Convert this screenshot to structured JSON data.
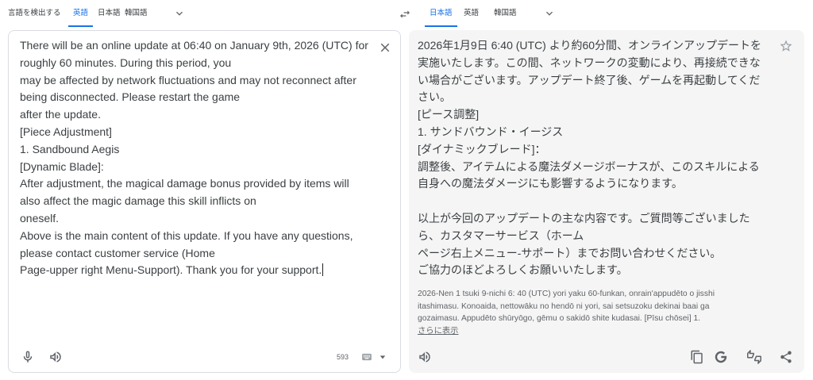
{
  "source_languages": {
    "tabs": [
      {
        "label": "言語を検出する",
        "active": false
      },
      {
        "label": "英語",
        "active": true
      },
      {
        "label": "日本語",
        "active": false
      },
      {
        "label": "韓国語",
        "active": false
      }
    ],
    "more_icon": "chevron-down-icon"
  },
  "swap_icon": "swap-icon",
  "target_languages": {
    "tabs": [
      {
        "label": "日本語",
        "active": true
      },
      {
        "label": "英語",
        "active": false
      },
      {
        "label": "韓国語",
        "active": false
      }
    ],
    "more_icon": "chevron-down-icon"
  },
  "source": {
    "lines": [
      "There will be an online update at 06:40 on January 9th, 2026 (UTC) for",
      "roughly 60 minutes. During this period, you",
      "may be affected by network fluctuations and may not reconnect after",
      "being disconnected. Please restart the game",
      "after the update.",
      "[Piece Adjustment]",
      "1. Sandbound Aegis",
      "[Dynamic Blade]:",
      "After adjustment, the magical damage bonus provided by items will",
      "also affect the magic damage this skill inflicts on",
      "oneself.",
      "Above is the main content of this update. If you have any questions,",
      "please contact customer service (Home",
      "Page-upper right Menu-Support). Thank you for your support."
    ],
    "char_count": "593",
    "icons": {
      "clear": "close-icon",
      "voice_input": "mic-icon",
      "listen": "speaker-icon",
      "keyboard": "keyboard-icon",
      "keyboard_options": "caret-down-icon"
    }
  },
  "target": {
    "paragraphs": [
      [
        "2026年1月9日 6:40 (UTC) より約60分間、オンラインアップデートを",
        "実施いたします。この間、ネットワークの変動により、再接続できな",
        "い場合がございます。アップデート終了後、ゲームを再起動してくだ",
        "さい。",
        "[ピース調整]",
        "1. サンドバウンド・イージス",
        "[ダイナミックブレード]：",
        "調整後、アイテムによる魔法ダメージボーナスが、このスキルによる",
        "自身への魔法ダメージにも影響するようになります。"
      ],
      [
        "以上が今回のアップデートの主な内容です。ご質問等ございました",
        "ら、カスタマーサービス（ホーム",
        "ページ右上メニュー-サポート）までお問い合わせください。",
        "ご協力のほどよろしくお願いいたします。"
      ]
    ],
    "romanization_lines": [
      "2026-Nen 1 tsuki 9-nichi 6: 40 (UTC) yori yaku 60-funkan, onrain'appudēto o jisshi",
      "itashimasu. Konoaida, nettowāku no hendō ni yori, sai setsuzoku dekinai baai ga",
      "gozaimasu. Appudēto shūryōgo, gēmu o sakidō shite kudasai. [Pīsu chōsei] 1."
    ],
    "show_more": "さらに表示",
    "icons": {
      "save": "star-icon",
      "listen": "speaker-icon",
      "copy": "copy-icon",
      "google": "google-g-icon",
      "rate": "thumbs-up-down-icon",
      "share": "share-icon"
    }
  },
  "colors": {
    "accent": "#1a73e8",
    "text": "#3c4043",
    "muted": "#5f6368",
    "light_icon": "#9aa0a6",
    "border": "#dadce0",
    "target_panel_bg": "#f5f5f5"
  }
}
